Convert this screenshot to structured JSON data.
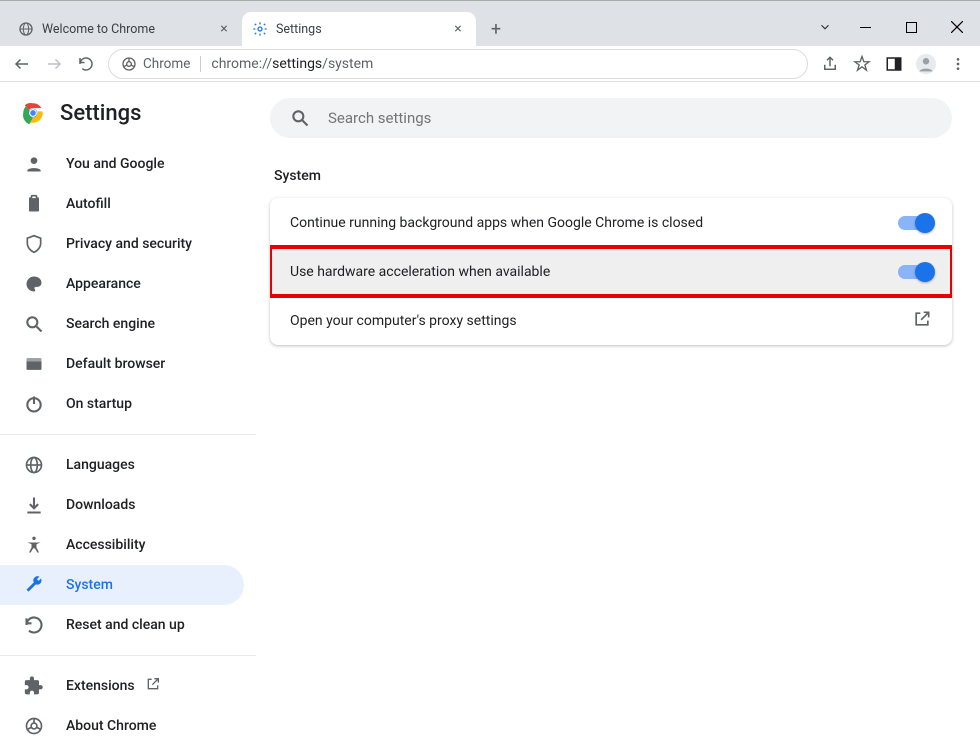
{
  "window": {
    "tabs": [
      {
        "title": "Welcome to Chrome"
      },
      {
        "title": "Settings"
      }
    ],
    "omnibox": {
      "chip": "Chrome",
      "url_prefix": "chrome://",
      "url_bold": "settings",
      "url_suffix": "/system"
    }
  },
  "sidebar": {
    "title": "Settings",
    "items": [
      {
        "label": "You and Google"
      },
      {
        "label": "Autofill"
      },
      {
        "label": "Privacy and security"
      },
      {
        "label": "Appearance"
      },
      {
        "label": "Search engine"
      },
      {
        "label": "Default browser"
      },
      {
        "label": "On startup"
      }
    ],
    "items2": [
      {
        "label": "Languages"
      },
      {
        "label": "Downloads"
      },
      {
        "label": "Accessibility"
      },
      {
        "label": "System"
      },
      {
        "label": "Reset and clean up"
      }
    ],
    "items3": [
      {
        "label": "Extensions"
      },
      {
        "label": "About Chrome"
      }
    ]
  },
  "main": {
    "search_placeholder": "Search settings",
    "section_title": "System",
    "rows": [
      {
        "label": "Continue running background apps when Google Chrome is closed"
      },
      {
        "label": "Use hardware acceleration when available"
      },
      {
        "label": "Open your computer's proxy settings"
      }
    ]
  }
}
